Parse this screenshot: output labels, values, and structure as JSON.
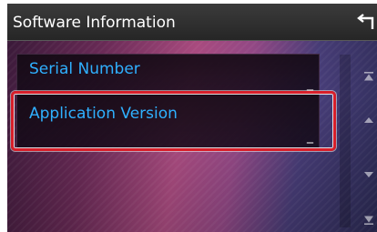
{
  "header": {
    "title": "Software Information",
    "back_icon": "return-arrow-icon"
  },
  "items": [
    {
      "label": "Serial Number",
      "value": "_"
    },
    {
      "label": "Application Version",
      "value": "_"
    }
  ],
  "scroll": {
    "buttons": [
      "scroll-top-icon",
      "scroll-up-icon",
      "scroll-down-icon",
      "scroll-bottom-icon"
    ]
  },
  "colors": {
    "accent_label": "#2fb0ff",
    "highlight_border": "#d81f2a",
    "header_bg": "#2e2e2e"
  }
}
